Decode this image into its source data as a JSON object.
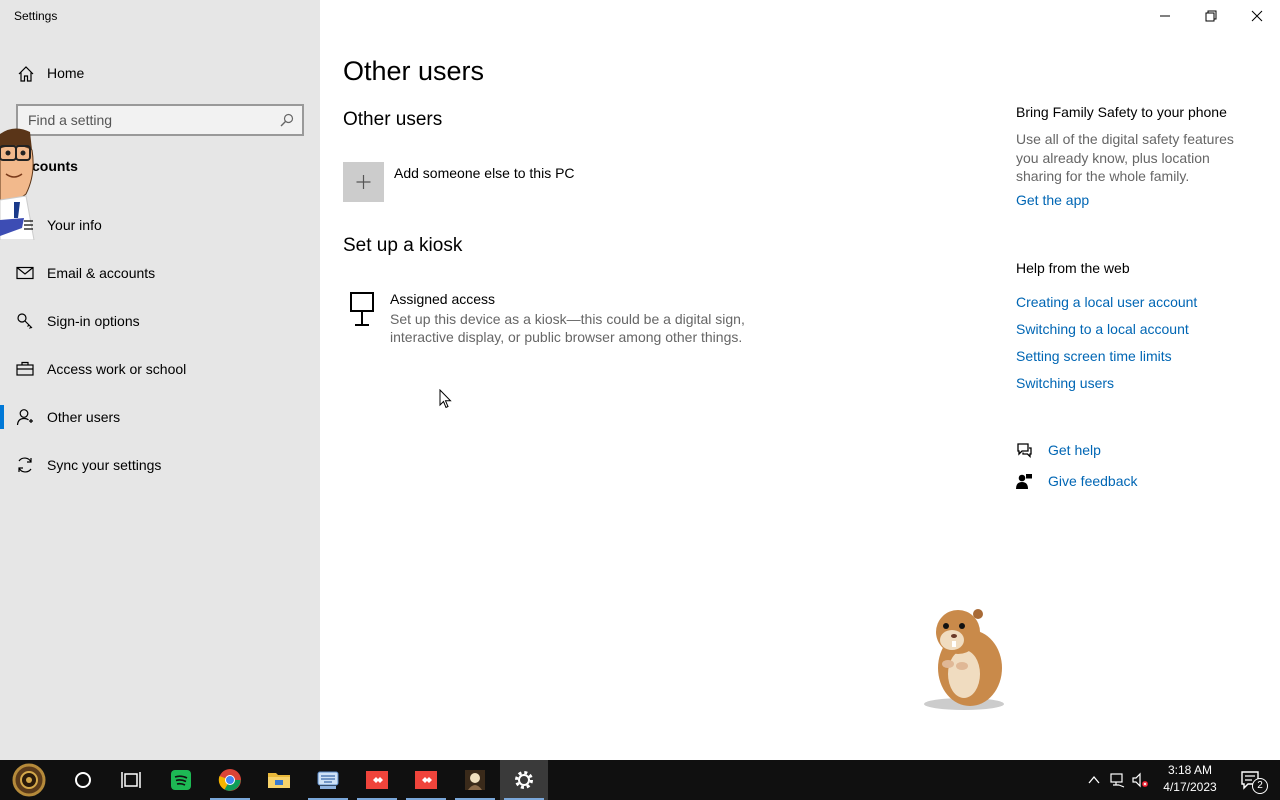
{
  "app": {
    "title": "Settings"
  },
  "sidebar": {
    "home_label": "Home",
    "search_placeholder": "Find a setting",
    "section_label": "Accounts",
    "section_label_visible": "counts",
    "items": [
      {
        "label": "Your info",
        "icon": "person-card-icon"
      },
      {
        "label": "Email & accounts",
        "icon": "mail-icon"
      },
      {
        "label": "Sign-in options",
        "icon": "key-icon"
      },
      {
        "label": "Access work or school",
        "icon": "briefcase-icon"
      },
      {
        "label": "Other users",
        "icon": "person-icon",
        "active": true
      },
      {
        "label": "Sync your settings",
        "icon": "sync-icon"
      }
    ]
  },
  "main": {
    "title": "Other users",
    "other_users_heading": "Other users",
    "add_user_label": "Add someone else to this PC",
    "kiosk_heading": "Set up a kiosk",
    "assigned_access_title": "Assigned access",
    "assigned_access_desc": "Set up this device as a kiosk—this could be a digital sign, interactive display, or public browser among other things."
  },
  "right": {
    "family_heading": "Bring Family Safety to your phone",
    "family_desc": "Use all of the digital safety features you already know, plus location sharing for the whole family.",
    "get_app": "Get the app",
    "help_heading": "Help from the web",
    "links": [
      "Creating a local user account",
      "Switching to a local account",
      "Setting screen time limits",
      "Switching users"
    ],
    "get_help": "Get help",
    "give_feedback": "Give feedback"
  },
  "taskbar": {
    "time": "3:18 AM",
    "date": "4/17/2023",
    "notifications": "2",
    "apps": [
      "start-button",
      "cortana",
      "task-view",
      "spotify",
      "chrome",
      "file-explorer",
      "keyboard-app",
      "anydesk",
      "anydesk-2",
      "media-app",
      "settings"
    ]
  },
  "colors": {
    "accent": "#0078d7",
    "link": "#0066b4",
    "sidebar_bg": "#e6e6e6",
    "taskbar_bg": "#101010"
  }
}
